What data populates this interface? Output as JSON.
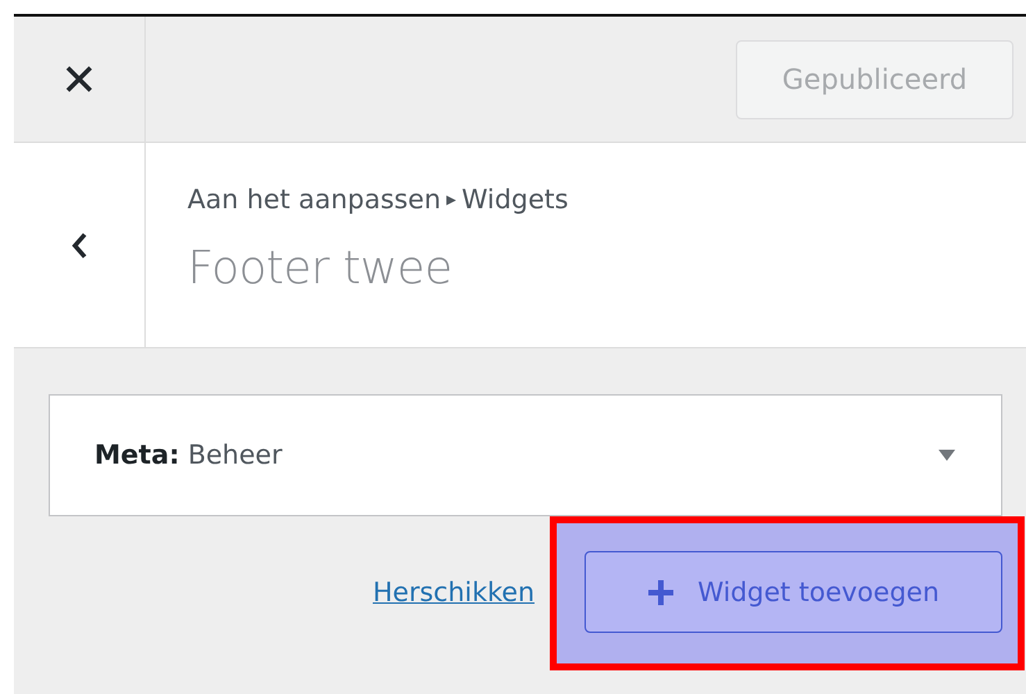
{
  "header": {
    "publish_button": {
      "label": "Gepubliceerd",
      "disabled": true
    }
  },
  "section": {
    "breadcrumb_prefix": "Aan het aanpassen",
    "breadcrumb_separator": "▸",
    "breadcrumb_parent": "Widgets",
    "title": "Footer twee"
  },
  "widgets": [
    {
      "title": "**Meta:** Beheer",
      "expanded": false
    }
  ],
  "reorder_link": "Herschikken",
  "add_button": {
    "label": "Widget toevoegen",
    "highlighted": true
  }
}
